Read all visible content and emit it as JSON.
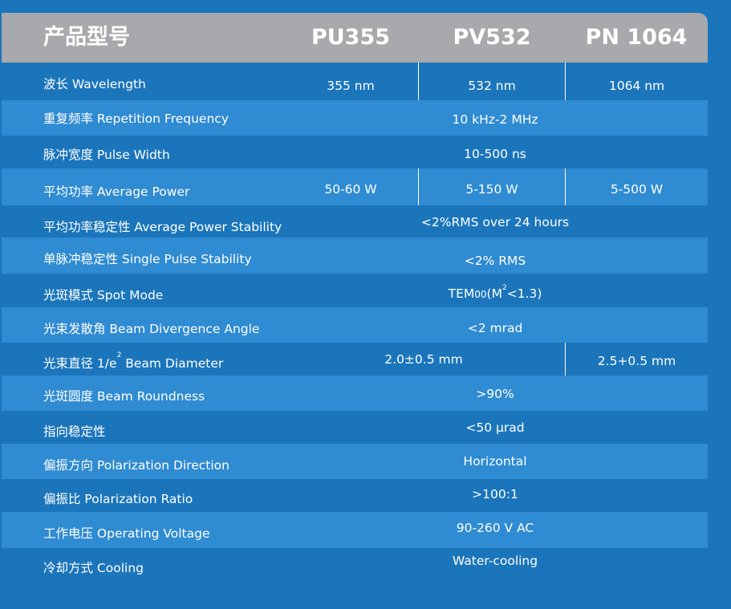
{
  "header": {
    "label": "产品型号",
    "models": [
      "PU355",
      "PV532",
      "PN 1064"
    ]
  },
  "rows": {
    "wavelength": {
      "label": "波长 Wavelength",
      "values": [
        "355 nm",
        "532 nm",
        "1064 nm"
      ]
    },
    "rep_freq": {
      "label": "重复频率 Repetition Frequency",
      "value": "10 kHz-2 MHz"
    },
    "pulse_width": {
      "label": "脉冲宽度 Pulse Width",
      "value": "10-500 ns"
    },
    "avg_power": {
      "label": "平均功率 Average Power",
      "values": [
        "50-60 W",
        "5-150 W",
        "5-500 W"
      ]
    },
    "avg_power_stability": {
      "label": "平均功率稳定性 Average Power Stability",
      "value": "<2%RMS over 24 hours"
    },
    "single_pulse_stability": {
      "label": "单脉冲稳定性 Single Pulse Stability",
      "value": "<2% RMS"
    },
    "spot_mode": {
      "label": "光斑模式 Spot Mode",
      "value_prefix": "TEM",
      "value_sub": "00",
      "value_mid": "(M",
      "value_sup": "2",
      "value_suffix": "<1.3)"
    },
    "divergence": {
      "label": "光束发散角 Beam Divergence Angle",
      "value": "<2 mrad"
    },
    "diameter": {
      "label_prefix": "光束直径 1/e",
      "label_sup": "2",
      "label_suffix": " Beam Diameter",
      "values": [
        "2.0±0.5 mm",
        "2.5+0.5 mm"
      ]
    },
    "roundness": {
      "label": "光斑圆度 Beam Roundness",
      "value": ">90%"
    },
    "pointing": {
      "label": "指向稳定性",
      "value": "<50 μrad"
    },
    "pol_direction": {
      "label": "偏振方向 Polarization Direction",
      "value": "Horizontal"
    },
    "pol_ratio": {
      "label": "偏振比 Polarization Ratio",
      "value": ">100:1"
    },
    "voltage": {
      "label": "工作电压 Operating Voltage",
      "value": "90-260 V AC"
    },
    "cooling": {
      "label": "冷却方式 Cooling",
      "value": "Water-cooling"
    }
  },
  "colors": {
    "background": "#1b75bb",
    "stripe": "#2f8bd2",
    "header": "#a7a9ac",
    "text": "#ffffff"
  }
}
